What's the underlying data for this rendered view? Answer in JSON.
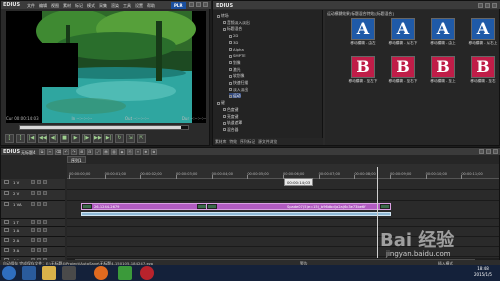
{
  "player": {
    "logo": "EDIUS",
    "menu": [
      "文件",
      "编辑",
      "视图",
      "素材",
      "标记",
      "模式",
      "采集",
      "渲染",
      "工具",
      "设置",
      "帮助"
    ],
    "plr_badge": "PLR",
    "timecodes": {
      "cur": "Cur 00:00:14:03",
      "in": "In --:--:--:--",
      "out": "Out --:--:--:--",
      "dur": "Dur --:--:--:--"
    },
    "progress_fraction": 0.96
  },
  "bin": {
    "title": "EDIUS",
    "tree": [
      {
        "label": "转场",
        "indent": 0
      },
      {
        "label": "音频淡入淡出",
        "indent": 1
      },
      {
        "label": "标题混合",
        "indent": 1
      },
      {
        "label": "2D",
        "indent": 2
      },
      {
        "label": "3D",
        "indent": 2
      },
      {
        "label": "Alpha",
        "indent": 2
      },
      {
        "label": "SMPTE",
        "indent": 2
      },
      {
        "label": "划像",
        "indent": 2
      },
      {
        "label": "激光",
        "indent": 2
      },
      {
        "label": "软划像",
        "indent": 2
      },
      {
        "label": "快速扫描",
        "indent": 2
      },
      {
        "label": "淡入淡出",
        "indent": 2
      },
      {
        "label": "运动",
        "indent": 2
      },
      {
        "label": "键",
        "indent": 0
      },
      {
        "label": "色度键",
        "indent": 1
      },
      {
        "label": "亮度键",
        "indent": 1
      },
      {
        "label": "轨道遮罩",
        "indent": 1
      },
      {
        "label": "混合器",
        "indent": 1
      }
    ],
    "tabs": [
      "素材库",
      "特效",
      "序列标记",
      "源文件浏览"
    ],
    "panel_title": "运动模糊效果(标题混合特效)[标题混合]",
    "thumbs": [
      {
        "letter": "A",
        "kind": "a",
        "caption": "移动模糊 - 由左"
      },
      {
        "letter": "A",
        "kind": "a",
        "caption": "移动模糊 - 从右下"
      },
      {
        "letter": "A",
        "kind": "a",
        "caption": "移动模糊 - 由上"
      },
      {
        "letter": "A",
        "kind": "a",
        "caption": "移动模糊 - 从右上"
      },
      {
        "letter": "B",
        "kind": "b",
        "caption": "移动模糊 - 至左下"
      },
      {
        "letter": "B",
        "kind": "b",
        "caption": "移动模糊 - 至右下"
      },
      {
        "letter": "B",
        "kind": "b",
        "caption": "移动模糊 - 至上"
      },
      {
        "letter": "B",
        "kind": "b",
        "caption": "移动模糊 - 至右"
      }
    ]
  },
  "timeline": {
    "logo": "EDIUS",
    "project_name": "无标题4",
    "sequence_tab": "序列1",
    "ruler_labels": [
      "00:00:00;00",
      "00:00:01;00",
      "00:00:02;00",
      "00:00:03;00",
      "00:00:04;00",
      "00:00:05;00",
      "00:00:06;00",
      "00:00:07;00",
      "00:00:08;00",
      "00:00:09;00",
      "00:00:10;00",
      "00:00:11;00"
    ],
    "ruler_tip": "00:00:14;03",
    "tracks": [
      {
        "name": "1 V",
        "kind": "v"
      },
      {
        "name": "2 V",
        "kind": "v"
      },
      {
        "name": "1 VA",
        "kind": "va"
      },
      {
        "name": "1 T",
        "kind": "t"
      },
      {
        "name": "1 A",
        "kind": "a"
      },
      {
        "name": "2 A",
        "kind": "a"
      },
      {
        "name": "3 A",
        "kind": "a"
      },
      {
        "name": "4 A",
        "kind": "a"
      }
    ],
    "clip_a_label": "26-1244-2679",
    "clip_b_label": "Spade07(5)e=15)_b96dbd(a2a)6c3e73be6f"
  },
  "status": {
    "text": "自动保存 完成保存文件：E:\\无标题4\\Project\\AutoSave\\无标题4-150105-184247.ezp",
    "right": "警告",
    "mode": "插入模式"
  },
  "taskbar": {
    "time": "18:48",
    "date": "2015/1/5"
  },
  "watermark": {
    "main": "Bai 经验",
    "sub": "jingyan.baidu.com"
  }
}
